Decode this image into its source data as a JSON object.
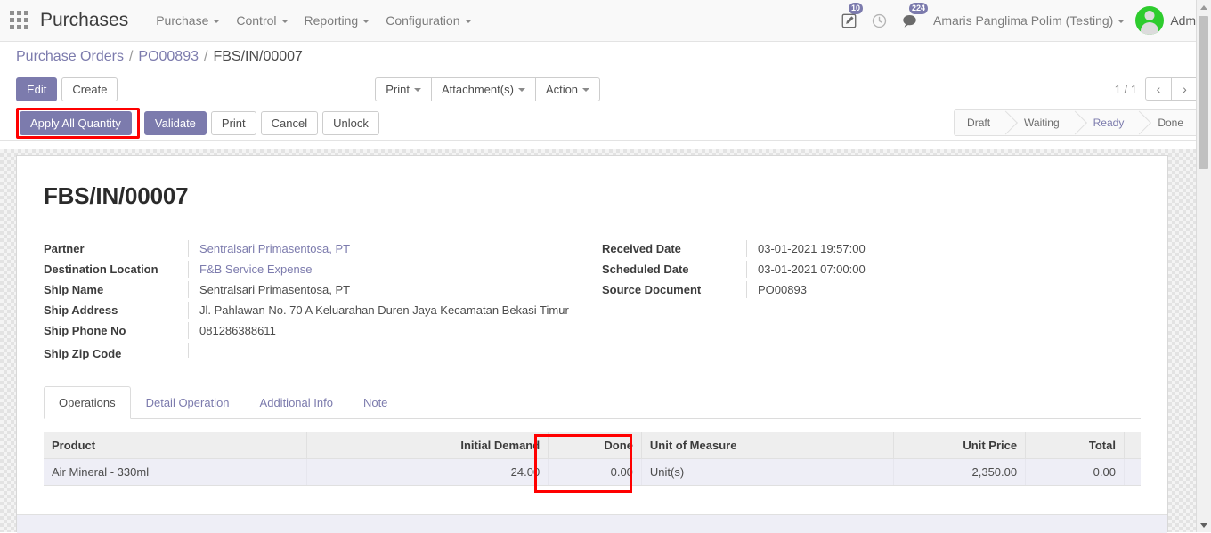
{
  "navbar": {
    "apps_icon": "apps-grid-icon",
    "brand": "Purchases",
    "menus": [
      {
        "label": "Purchase"
      },
      {
        "label": "Control"
      },
      {
        "label": "Reporting"
      },
      {
        "label": "Configuration"
      }
    ],
    "sysicons": [
      {
        "name": "activity-edit-icon",
        "glyph": "✎",
        "badge": "10"
      },
      {
        "name": "clock-icon",
        "glyph": "○",
        "badge": ""
      },
      {
        "name": "messages-icon",
        "glyph": "●",
        "badge": "224"
      }
    ],
    "company": "Amaris Panglima Polim (Testing)",
    "user": "Admin"
  },
  "breadcrumb": {
    "root": "Purchase Orders",
    "parent": "PO00893",
    "current": "FBS/IN/00007",
    "separator": "/"
  },
  "controls": {
    "edit": "Edit",
    "create": "Create",
    "print": "Print",
    "attachments": "Attachment(s)",
    "action": "Action",
    "pager": "1 / 1",
    "prev": "‹",
    "next": "›"
  },
  "statusbar": {
    "buttons": [
      {
        "label": "Apply All Quantity",
        "style": "primary",
        "highlighted": true
      },
      {
        "label": "Validate",
        "style": "primary",
        "highlighted": false
      },
      {
        "label": "Print",
        "style": "default",
        "highlighted": false
      },
      {
        "label": "Cancel",
        "style": "default",
        "highlighted": false
      },
      {
        "label": "Unlock",
        "style": "default",
        "highlighted": false
      }
    ],
    "stages": [
      {
        "label": "Draft",
        "active": false
      },
      {
        "label": "Waiting",
        "active": false
      },
      {
        "label": "Ready",
        "active": true
      },
      {
        "label": "Done",
        "active": false
      }
    ]
  },
  "form": {
    "title": "FBS/IN/00007",
    "left_fields": [
      {
        "label": "Partner",
        "value": "Sentralsari Primasentosa, PT",
        "link": true
      },
      {
        "label": "Destination Location",
        "value": "F&B Service Expense",
        "link": true
      },
      {
        "label": "Ship Name",
        "value": "Sentralsari Primasentosa, PT",
        "link": false
      },
      {
        "label": "Ship Address",
        "value": "Jl. Pahlawan No. 70 A Keluarahan Duren Jaya Kecamatan Bekasi Timur",
        "link": false
      },
      {
        "label": "Ship Phone No",
        "value": "081286388611",
        "link": false
      },
      {
        "label": "Ship Zip Code",
        "value": "",
        "link": false
      }
    ],
    "right_fields": [
      {
        "label": "Received Date",
        "value": "03-01-2021 19:57:00"
      },
      {
        "label": "Scheduled Date",
        "value": "03-01-2021 07:00:00"
      },
      {
        "label": "Source Document",
        "value": "PO00893"
      }
    ]
  },
  "tabs": [
    {
      "label": "Operations",
      "active": true
    },
    {
      "label": "Detail Operation",
      "active": false
    },
    {
      "label": "Additional Info",
      "active": false
    },
    {
      "label": "Note",
      "active": false
    }
  ],
  "table": {
    "columns": [
      {
        "label": "Product",
        "align": "left"
      },
      {
        "label": "Initial Demand",
        "align": "right"
      },
      {
        "label": "Done",
        "align": "right"
      },
      {
        "label": "Unit of Measure",
        "align": "left"
      },
      {
        "label": "Unit Price",
        "align": "right"
      },
      {
        "label": "Total",
        "align": "right"
      }
    ],
    "rows": [
      {
        "product": "Air Mineral - 330ml",
        "initial_demand": "24.00",
        "done": "0.00",
        "uom": "Unit(s)",
        "unit_price": "2,350.00",
        "total": "0.00"
      }
    ]
  },
  "colors": {
    "accent": "#7c7bad",
    "highlight": "#ff0000",
    "row_bg": "#eeeef6",
    "header_bg": "#eeeeee"
  }
}
